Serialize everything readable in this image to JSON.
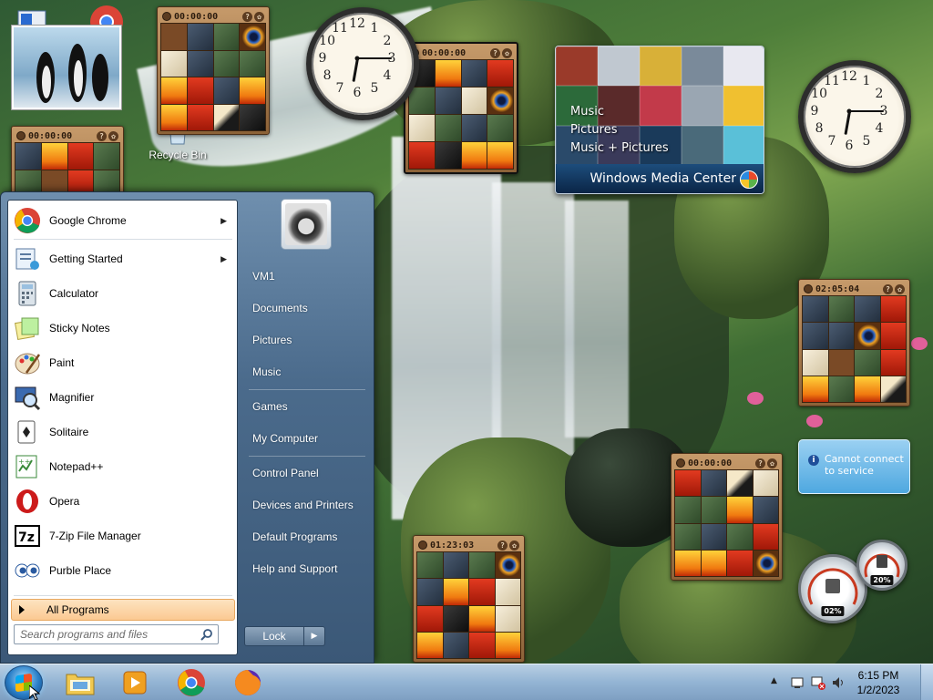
{
  "desktop": {
    "icons": [
      {
        "label": "Recycle Bin"
      }
    ],
    "puzzle_timers": [
      "00:00:00",
      "00:00:00",
      "00:00:00",
      "02:05:04",
      "00:00:00",
      "01:23:03"
    ],
    "media_center": {
      "menu": [
        "Music",
        "Pictures",
        "Music + Pictures"
      ],
      "brand": "Windows Media Center"
    },
    "clock_numbers": [
      "12",
      "1",
      "2",
      "3",
      "4",
      "5",
      "6",
      "7",
      "8",
      "9",
      "10",
      "11"
    ],
    "notification": "Cannot connect to service",
    "meter": {
      "cpu_percent": "02%",
      "memory_percent": "20%"
    }
  },
  "start_menu": {
    "programs": [
      {
        "label": "Google Chrome",
        "icon": "chrome-icon",
        "submenu": true
      },
      {
        "label": "Getting Started",
        "icon": "getting-started-icon",
        "submenu": true
      },
      {
        "label": "Calculator",
        "icon": "calculator-icon",
        "submenu": false
      },
      {
        "label": "Sticky Notes",
        "icon": "sticky-notes-icon",
        "submenu": false
      },
      {
        "label": "Paint",
        "icon": "paint-icon",
        "submenu": false
      },
      {
        "label": "Magnifier",
        "icon": "magnifier-icon",
        "submenu": false
      },
      {
        "label": "Solitaire",
        "icon": "solitaire-icon",
        "submenu": false
      },
      {
        "label": "Notepad++",
        "icon": "notepadpp-icon",
        "submenu": false
      },
      {
        "label": "Opera",
        "icon": "opera-icon",
        "submenu": false
      },
      {
        "label": "7-Zip File Manager",
        "icon": "7zip-icon",
        "submenu": false
      },
      {
        "label": "Purble Place",
        "icon": "purble-place-icon",
        "submenu": false
      }
    ],
    "all_programs": "All Programs",
    "search_placeholder": "Search programs and files",
    "right_items": [
      {
        "label": "VM1"
      },
      {
        "label": "Documents"
      },
      {
        "label": "Pictures"
      },
      {
        "label": "Music"
      },
      {
        "label": "Games"
      },
      {
        "label": "My Computer"
      },
      {
        "label": "Control Panel"
      },
      {
        "label": "Devices and Printers"
      },
      {
        "label": "Default Programs"
      },
      {
        "label": "Help and Support"
      }
    ],
    "lock_label": "Lock"
  },
  "taskbar": {
    "pinned": [
      "explorer-icon",
      "media-player-icon",
      "chrome-icon",
      "firefox-icon"
    ],
    "time": "6:15 PM",
    "date": "1/2/2023"
  }
}
